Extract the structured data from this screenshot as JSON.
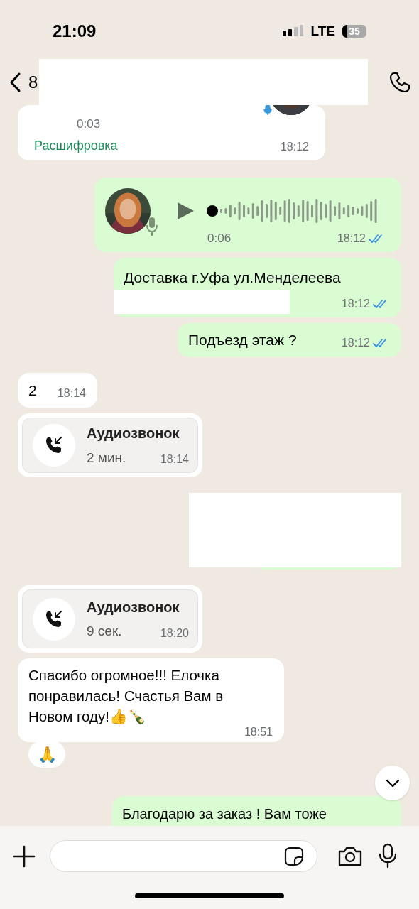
{
  "status_bar": {
    "time": "21:09",
    "network": "LTE",
    "battery": "35"
  },
  "header": {
    "title": "8",
    "redacted": true
  },
  "messages": [
    {
      "kind": "voice",
      "outgoing": false,
      "duration": "0:03",
      "transcript_link": "Расшифровка",
      "time": "18:12"
    },
    {
      "kind": "voice",
      "outgoing": true,
      "duration": "0:06",
      "time": "18:12",
      "read": true
    },
    {
      "kind": "text",
      "outgoing": true,
      "text": "Доставка г.Уфа ул.Менделеева",
      "redacted": true,
      "time": "18:12",
      "read": true
    },
    {
      "kind": "text",
      "outgoing": true,
      "text": "Подъезд этаж ?",
      "time": "18:12",
      "read": true
    },
    {
      "kind": "text",
      "outgoing": false,
      "text": "2",
      "time": "18:14"
    },
    {
      "kind": "call",
      "outgoing": false,
      "title": "Аудиозвонок",
      "duration": "2 мин.",
      "time": "18:14"
    },
    {
      "kind": "hidden",
      "outgoing": true
    },
    {
      "kind": "call",
      "outgoing": false,
      "title": "Аудиозвонок",
      "duration": "9 сек.",
      "time": "18:20"
    },
    {
      "kind": "text",
      "outgoing": false,
      "text": "Спасибо огромное!!! Елочка понравилась! Счастья Вам в Новом году!👍🍾",
      "time": "18:51",
      "reaction": "🙏"
    },
    {
      "kind": "text",
      "outgoing": true,
      "text": "Благодарю за заказ ! Вам тоже"
    }
  ]
}
